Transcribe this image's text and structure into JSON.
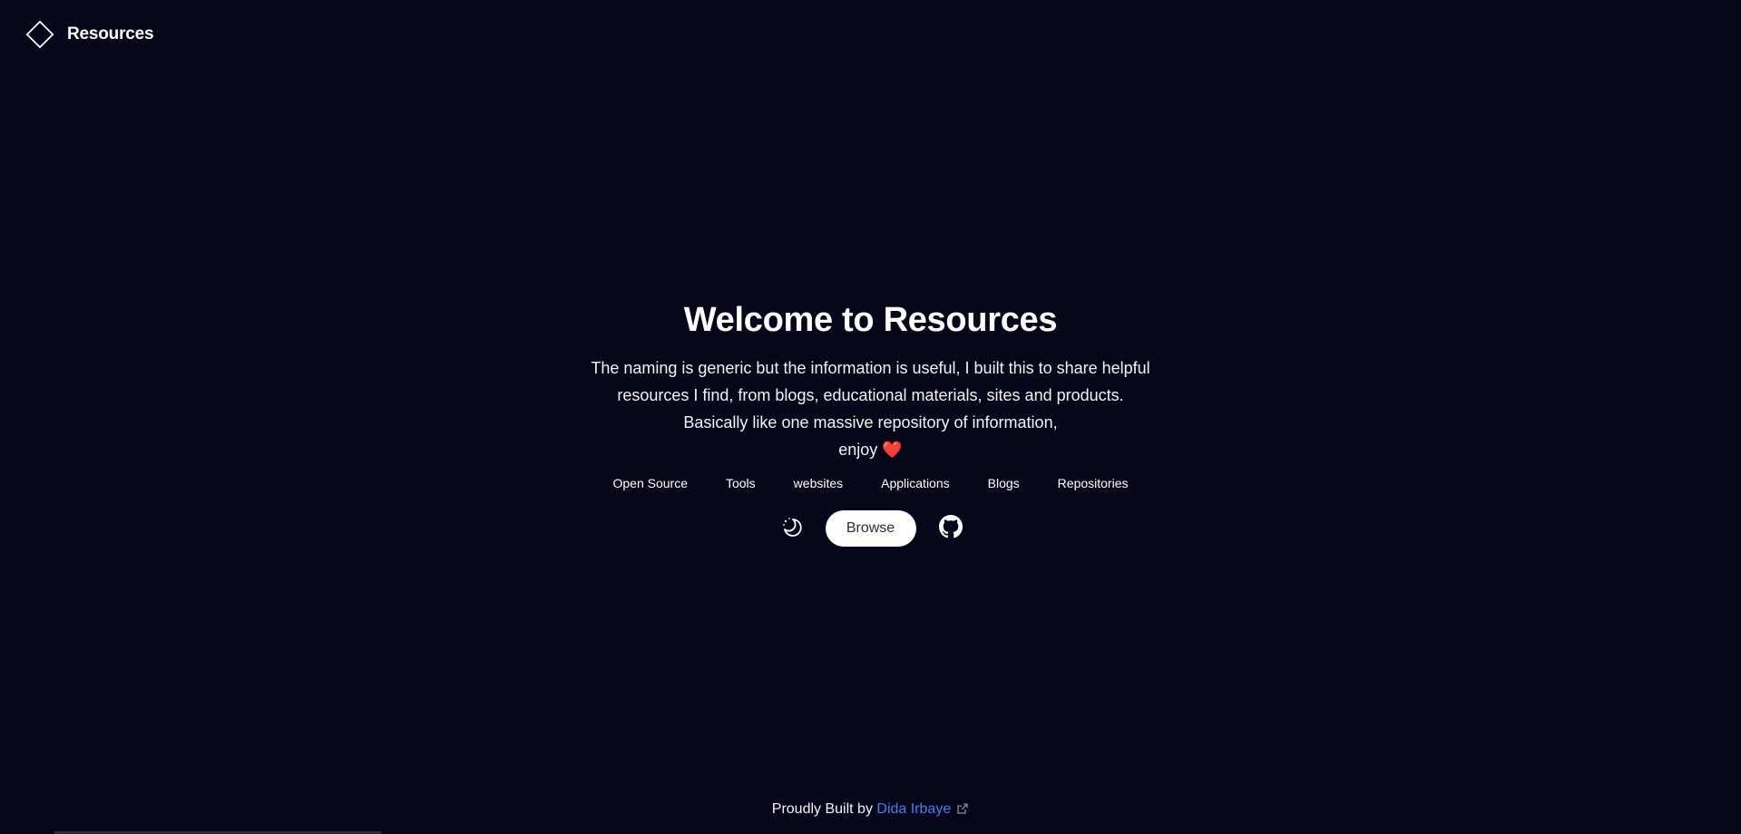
{
  "brand": {
    "name": "Resources",
    "logo_icon": "diamond-outline-icon"
  },
  "hero": {
    "title": "Welcome to Resources",
    "description_lines": [
      "The naming is generic but the information is useful, I built this to share helpful",
      "resources I find, from blogs, educational materials, sites and products.",
      "Basically like one massive repository of information,",
      "enjoy"
    ],
    "heart": "❤️"
  },
  "categories": [
    "Open Source",
    "Tools",
    "websites",
    "Applications",
    "Blogs",
    "Repositories"
  ],
  "actions": {
    "theme_icon": "moon-sparkle-icon",
    "browse_label": "Browse",
    "github_icon": "github-icon"
  },
  "footer": {
    "prefix": "Proudly Built by",
    "author": "Dida Irbaye",
    "external_icon": "external-link-icon"
  },
  "colors": {
    "background": "#06061a",
    "text": "#ffffff",
    "link": "#3b82f6",
    "heart": "#e53b4a"
  }
}
